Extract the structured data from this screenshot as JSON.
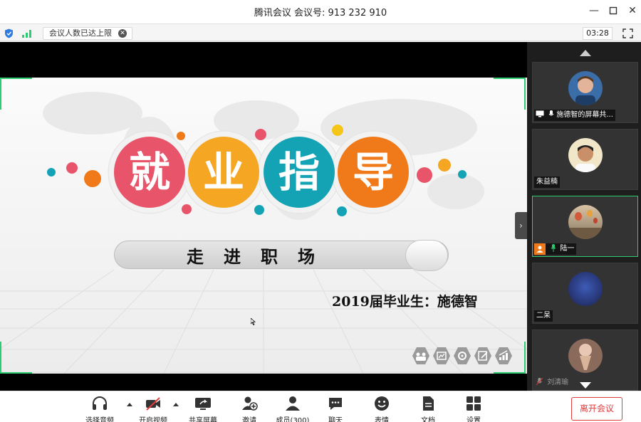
{
  "window": {
    "title": "腾讯会议 会议号: 913 232 910",
    "controls": [
      "minimize-icon",
      "maximize-icon",
      "close-icon"
    ]
  },
  "status_bar": {
    "notice": "会议人数已达上限",
    "timer": "03:28",
    "icons": [
      "shield-icon",
      "signal-icon",
      "fullscreen-icon"
    ]
  },
  "slide": {
    "title_chars": [
      "就",
      "业",
      "指",
      "导"
    ],
    "title_colors": [
      "#e8556a",
      "#f5a623",
      "#13a3b4",
      "#f07a1a"
    ],
    "subtitle": "走进职场",
    "author": "2019届毕业生：施德智"
  },
  "participants": [
    {
      "name": "施德智的屏幕共...",
      "state": "sharing"
    },
    {
      "name": "朱益楠",
      "state": "normal"
    },
    {
      "name": "陆一",
      "state": "speaking"
    },
    {
      "name": "二呆",
      "state": "normal"
    },
    {
      "name": "刘清瑜",
      "state": "muted"
    }
  ],
  "toolbar": {
    "buttons": [
      {
        "label": "选择音频",
        "icon": "headset-icon"
      },
      {
        "label": "开启视频",
        "icon": "video-off-icon"
      },
      {
        "label": "共享屏幕",
        "icon": "share-screen-icon"
      },
      {
        "label": "邀请",
        "icon": "invite-icon"
      },
      {
        "label": "成员(300)",
        "icon": "members-icon"
      },
      {
        "label": "聊天",
        "icon": "chat-icon"
      },
      {
        "label": "表情",
        "icon": "emoji-icon"
      },
      {
        "label": "文档",
        "icon": "document-icon"
      },
      {
        "label": "设置",
        "icon": "settings-icon"
      }
    ],
    "leave_label": "离开会议"
  }
}
